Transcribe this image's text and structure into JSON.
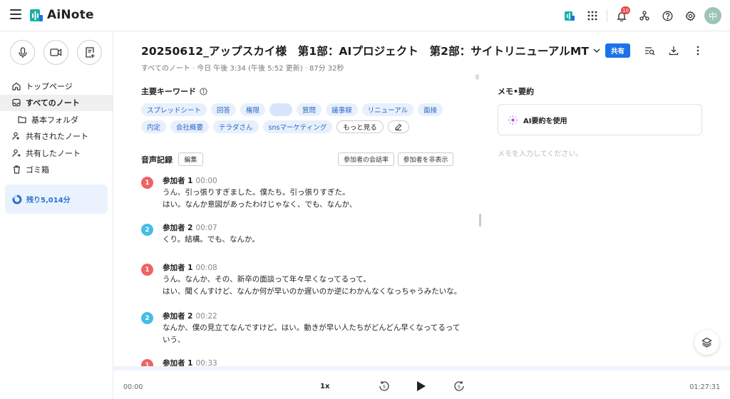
{
  "app": {
    "name": "AiNote",
    "notification_count": "10",
    "avatar_initial": "中"
  },
  "sidebar": {
    "items": [
      {
        "label": "トップページ",
        "icon": "home-icon"
      },
      {
        "label": "すべてのノート",
        "icon": "inbox-icon",
        "active": true
      },
      {
        "label": "基本フォルダ",
        "icon": "folder-icon"
      },
      {
        "label": "共有されたノート",
        "icon": "user-shared-icon"
      },
      {
        "label": "共有したノート",
        "icon": "user-share-icon"
      },
      {
        "label": "ゴミ箱",
        "icon": "trash-icon"
      }
    ],
    "remaining": "残り5,014分"
  },
  "note": {
    "title": "20250612_アップスカイ様　第1部：AIプロジェクト　第2部：サイトリニューアルMT",
    "breadcrumb": "すべてのノート",
    "updated": "今日 午後 3:34 (午後 5:52 更新)",
    "duration": "87分 32秒",
    "share_label": "共有"
  },
  "keywords": {
    "label": "主要キーワード",
    "chips": [
      "スプレッドシート",
      "回答",
      "権限",
      "",
      "質問",
      "議事録",
      "リニューアル",
      "面接",
      "内定",
      "会社概要",
      "テラダさん",
      "snsマーケティング"
    ],
    "more_label": "もっと見る"
  },
  "recording": {
    "label": "音声記録",
    "edit_label": "編集",
    "ratio_label": "参加者の会話率",
    "hide_label": "参加者を非表示"
  },
  "transcript": [
    {
      "num": "1",
      "speaker": "参加者 1",
      "time": "00:00",
      "color": "#f06262",
      "lines": [
        "うん、引っ張りすぎました。僕たち。引っ張りすぎた。",
        "はい。なんか意図があったわけじゃなく、でも、なんか、"
      ]
    },
    {
      "num": "2",
      "speaker": "参加者 2",
      "time": "00:07",
      "color": "#45bde9",
      "lines": [
        "くり。結構。でも、なんか。"
      ]
    },
    {
      "num": "1",
      "speaker": "参加者 1",
      "time": "00:08",
      "color": "#f06262",
      "lines": [
        "うん。なんか、その、新卒の面談って年々早くなってるって。",
        "はい、聞くんすけど、なんか何が早いのか遅いのか逆にわかんなくなっちゃうみたいな。"
      ]
    },
    {
      "num": "2",
      "speaker": "参加者 2",
      "time": "00:22",
      "color": "#45bde9",
      "lines": [
        "なんか、僕の見立てなんですけど。はい。動きが早い人たちがどんどん早くなってるって",
        "いう、"
      ]
    },
    {
      "num": "1",
      "speaker": "参加者 1",
      "time": "00:33",
      "color": "#f06262",
      "lines": [
        ""
      ]
    }
  ],
  "memo": {
    "title": "メモ•要約",
    "ai_label": "AI要約を使用",
    "placeholder": "メモを入力してください。"
  },
  "player": {
    "current": "00:00",
    "total": "01:27:31",
    "speed": "1x",
    "skip_seconds": "5",
    "progress": 0
  }
}
